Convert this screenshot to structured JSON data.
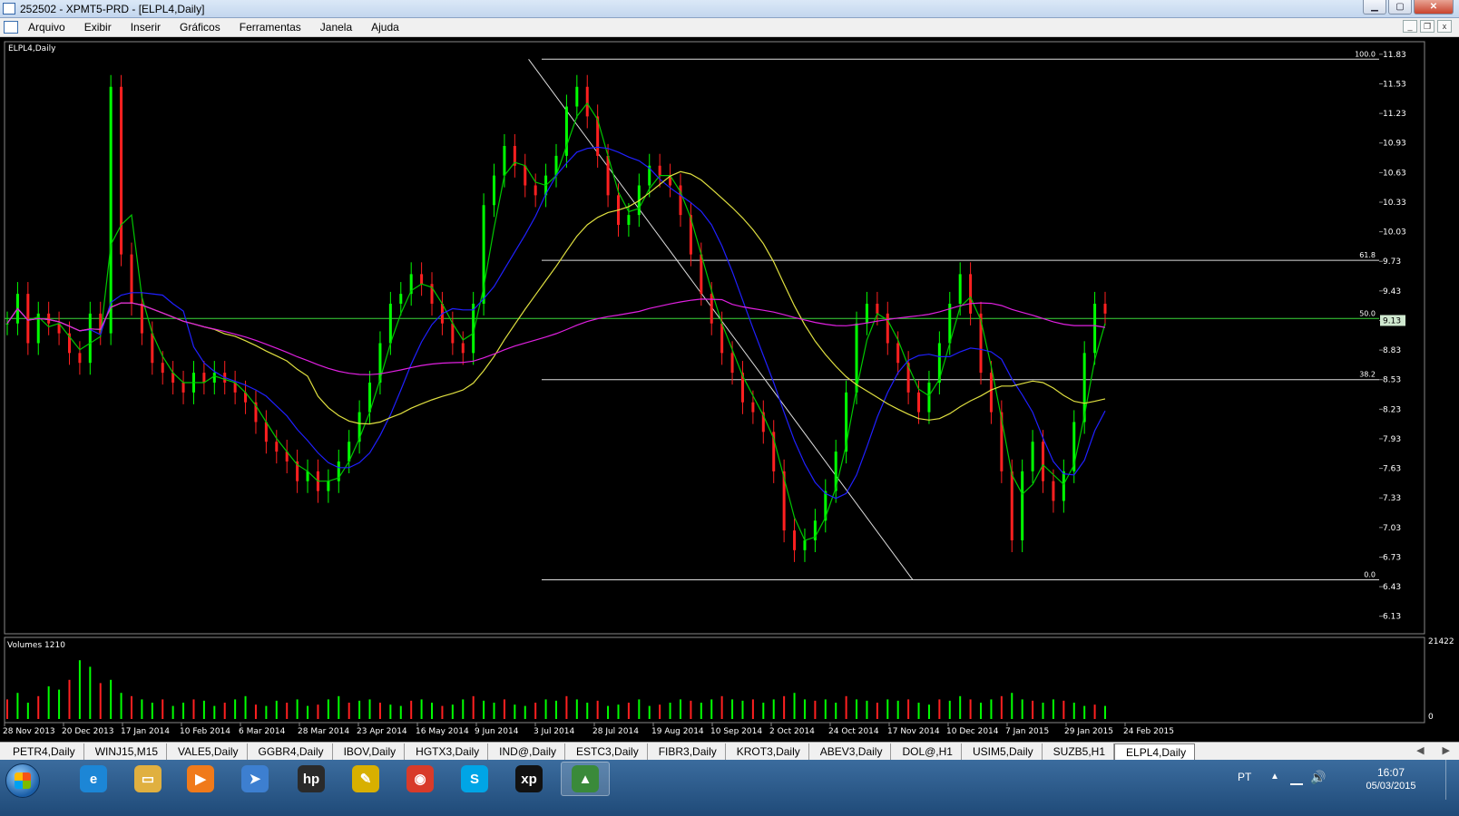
{
  "window": {
    "title": "252502 - XPMT5-PRD - [ELPL4,Daily]",
    "min": "▁",
    "max": "▢",
    "close": "✕"
  },
  "menu": [
    "Arquivo",
    "Exibir",
    "Inserir",
    "Gráficos",
    "Ferramentas",
    "Janela",
    "Ajuda"
  ],
  "mdi": {
    "min": "_",
    "restore": "❐",
    "close": "x"
  },
  "chart_data": {
    "type": "candlestick",
    "title": "ELPL4,Daily",
    "price_axis": [
      "11.83",
      "11.53",
      "11.23",
      "10.93",
      "10.63",
      "10.33",
      "10.03",
      "9.73",
      "9.43",
      "9.13",
      "8.83",
      "8.53",
      "8.23",
      "7.93",
      "7.63",
      "7.33",
      "7.03",
      "6.73",
      "6.43",
      "6.13"
    ],
    "ylim": [
      5.98,
      11.93
    ],
    "current_price": "9.13",
    "date_axis": [
      "28 Nov 2013",
      "20 Dec 2013",
      "17 Jan 2014",
      "10 Feb 2014",
      "6 Mar 2014",
      "28 Mar 2014",
      "23 Apr 2014",
      "16 May 2014",
      "9 Jun 2014",
      "3 Jul 2014",
      "28 Jul 2014",
      "19 Aug 2014",
      "10 Sep 2014",
      "2 Oct 2014",
      "24 Oct 2014",
      "17 Nov 2014",
      "10 Dec 2014",
      "7 Jan 2015",
      "29 Jan 2015",
      "24 Feb 2015"
    ],
    "close_series": [
      9.1,
      9.4,
      8.9,
      9.2,
      9.1,
      9.0,
      8.8,
      8.7,
      9.2,
      9.0,
      11.5,
      9.8,
      9.3,
      9.0,
      8.7,
      8.6,
      8.5,
      8.4,
      8.6,
      8.5,
      8.6,
      8.5,
      8.4,
      8.3,
      8.1,
      7.9,
      7.8,
      7.7,
      7.5,
      7.6,
      7.4,
      7.5,
      7.7,
      7.9,
      8.2,
      8.5,
      8.9,
      9.3,
      9.4,
      9.6,
      9.5,
      9.3,
      9.1,
      8.9,
      8.8,
      9.3,
      10.3,
      10.6,
      10.9,
      10.7,
      10.5,
      10.4,
      10.6,
      10.8,
      11.3,
      11.5,
      11.2,
      10.8,
      10.4,
      10.1,
      10.2,
      10.5,
      10.7,
      10.6,
      10.5,
      10.2,
      9.8,
      9.4,
      9.1,
      8.8,
      8.6,
      8.3,
      8.2,
      8.0,
      7.6,
      7.0,
      6.8,
      6.9,
      7.1,
      7.4,
      7.8,
      8.4,
      9.1,
      9.3,
      9.2,
      8.9,
      8.7,
      8.4,
      8.2,
      8.5,
      8.9,
      9.3,
      9.6,
      9.2,
      8.6,
      8.2,
      7.6,
      6.9,
      7.6,
      7.9,
      7.5,
      7.3,
      7.6,
      8.1,
      8.8,
      9.3,
      9.2
    ],
    "volume_label": "Volumes 1210",
    "volume_axis": [
      "21422",
      "0"
    ],
    "volume_series": [
      0.3,
      0.4,
      0.25,
      0.35,
      0.5,
      0.45,
      0.6,
      0.9,
      0.8,
      0.55,
      0.6,
      0.4,
      0.35,
      0.3,
      0.25,
      0.3,
      0.2,
      0.25,
      0.3,
      0.28,
      0.2,
      0.25,
      0.3,
      0.35,
      0.22,
      0.2,
      0.28,
      0.25,
      0.3,
      0.2,
      0.22,
      0.3,
      0.35,
      0.25,
      0.28,
      0.3,
      0.25,
      0.22,
      0.2,
      0.28,
      0.3,
      0.25,
      0.2,
      0.22,
      0.3,
      0.35,
      0.28,
      0.25,
      0.3,
      0.22,
      0.2,
      0.25,
      0.3,
      0.28,
      0.35,
      0.3,
      0.25,
      0.28,
      0.2,
      0.22,
      0.25,
      0.3,
      0.2,
      0.22,
      0.25,
      0.3,
      0.28,
      0.25,
      0.3,
      0.35,
      0.3,
      0.28,
      0.3,
      0.25,
      0.3,
      0.35,
      0.4,
      0.3,
      0.28,
      0.3,
      0.25,
      0.35,
      0.3,
      0.28,
      0.25,
      0.3,
      0.28,
      0.3,
      0.25,
      0.22,
      0.3,
      0.28,
      0.35,
      0.3,
      0.25,
      0.3,
      0.35,
      0.4,
      0.3,
      0.28,
      0.25,
      0.3,
      0.28,
      0.25,
      0.2,
      0.22,
      0.2
    ],
    "series": [
      {
        "name": "green",
        "color": "#00c800"
      },
      {
        "name": "blue",
        "color": "#2020ff"
      },
      {
        "name": "yellow",
        "color": "#e0e040"
      },
      {
        "name": "magenta",
        "color": "#e020e0"
      }
    ],
    "fibonacci": [
      {
        "label": "100.0",
        "price": 11.78
      },
      {
        "label": "61.8",
        "price": 9.74
      },
      {
        "label": "50.0",
        "price": 9.15
      },
      {
        "label": "38.2",
        "price": 8.53
      },
      {
        "label": "0.0",
        "price": 6.5
      }
    ],
    "trendline": {
      "from": [
        0.38,
        11.78
      ],
      "to": [
        0.66,
        6.5
      ]
    },
    "bull_color": "#00ff00",
    "bear_color": "#ff2020"
  },
  "tabs": [
    "PETR4,Daily",
    "WINJ15,M15",
    "VALE5,Daily",
    "GGBR4,Daily",
    "IBOV,Daily",
    "HGTX3,Daily",
    "IND@,Daily",
    "ESTC3,Daily",
    "FIBR3,Daily",
    "KROT3,Daily",
    "ABEV3,Daily",
    "DOL@,H1",
    "USIM5,Daily",
    "SUZB5,H1",
    "ELPL4,Daily"
  ],
  "active_tab": "ELPL4,Daily",
  "tabs_nav": {
    "prev": "◀",
    "next": "▶"
  },
  "taskbar": {
    "apps": [
      {
        "name": "ie",
        "glyph": "e",
        "color": "#1c86d6"
      },
      {
        "name": "explorer",
        "glyph": "▭",
        "color": "#e0b040"
      },
      {
        "name": "media",
        "glyph": "▶",
        "color": "#f07a1a"
      },
      {
        "name": "dreamweaver",
        "glyph": "➤",
        "color": "#3d7fd0"
      },
      {
        "name": "hp",
        "glyph": "hp",
        "color": "#2a2a2a"
      },
      {
        "name": "tool",
        "glyph": "✎",
        "color": "#d8b000"
      },
      {
        "name": "chrome",
        "glyph": "◉",
        "color": "#d83b2a"
      },
      {
        "name": "skype",
        "glyph": "S",
        "color": "#00a5e6"
      },
      {
        "name": "xp",
        "glyph": "xp",
        "color": "#111"
      },
      {
        "name": "metatrader",
        "glyph": "▲",
        "color": "#3a8a3a"
      }
    ],
    "lang": "PT",
    "time": "16:07",
    "date": "05/03/2015"
  }
}
